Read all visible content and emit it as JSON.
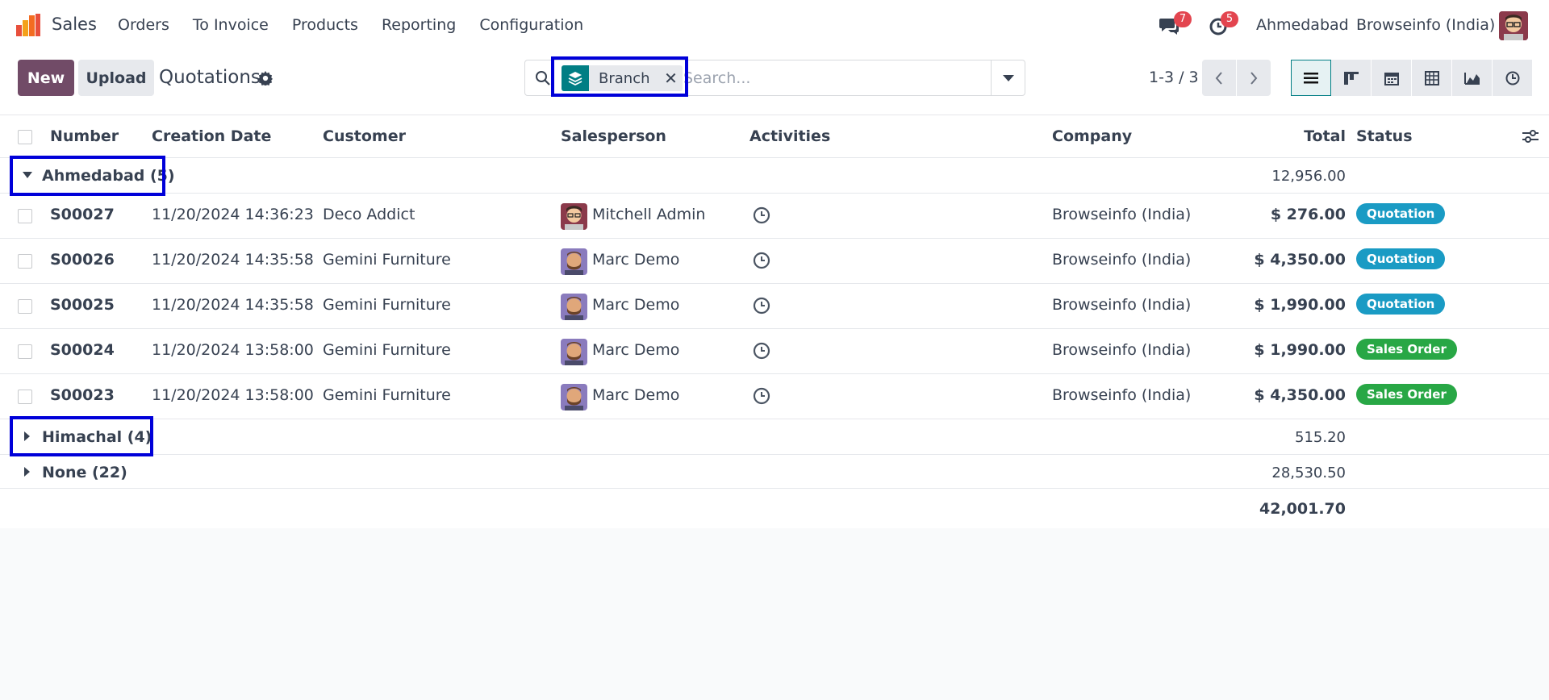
{
  "navbar": {
    "app_name": "Sales",
    "menu": [
      "Orders",
      "To Invoice",
      "Products",
      "Reporting",
      "Configuration"
    ],
    "messages_count": "7",
    "activities_count": "5",
    "branch": "Ahmedabad",
    "company": "Browseinfo (India)"
  },
  "control": {
    "new_label": "New",
    "upload_label": "Upload",
    "title": "Quotations",
    "facet_label": "Branch",
    "search_placeholder": "Search...",
    "pager": "1-3 / 3"
  },
  "table": {
    "headers": {
      "number": "Number",
      "creation_date": "Creation Date",
      "customer": "Customer",
      "salesperson": "Salesperson",
      "activities": "Activities",
      "company": "Company",
      "total": "Total",
      "status": "Status"
    },
    "groups": [
      {
        "label": "Ahmedabad (5)",
        "total": "12,956.00",
        "expanded": true
      },
      {
        "label": "Himachal (4)",
        "total": "515.20",
        "expanded": false
      },
      {
        "label": "None (22)",
        "total": "28,530.50",
        "expanded": false
      }
    ],
    "rows": [
      {
        "number": "S00027",
        "date": "11/20/2024 14:36:23",
        "customer": "Deco Addict",
        "salesperson": "Mitchell Admin",
        "company": "Browseinfo (India)",
        "total": "$ 276.00",
        "status": "Quotation"
      },
      {
        "number": "S00026",
        "date": "11/20/2024 14:35:58",
        "customer": "Gemini Furniture",
        "salesperson": "Marc Demo",
        "company": "Browseinfo (India)",
        "total": "$ 4,350.00",
        "status": "Quotation"
      },
      {
        "number": "S00025",
        "date": "11/20/2024 14:35:58",
        "customer": "Gemini Furniture",
        "salesperson": "Marc Demo",
        "company": "Browseinfo (India)",
        "total": "$ 1,990.00",
        "status": "Quotation"
      },
      {
        "number": "S00024",
        "date": "11/20/2024 13:58:00",
        "customer": "Gemini Furniture",
        "salesperson": "Marc Demo",
        "company": "Browseinfo (India)",
        "total": "$ 1,990.00",
        "status": "Sales Order"
      },
      {
        "number": "S00023",
        "date": "11/20/2024 13:58:00",
        "customer": "Gemini Furniture",
        "salesperson": "Marc Demo",
        "company": "Browseinfo (India)",
        "total": "$ 4,350.00",
        "status": "Sales Order"
      }
    ],
    "grand_total": "42,001.70"
  },
  "colors": {
    "brand": "#714b67",
    "teal": "#017e84",
    "quotation_badge": "#1a9bc4",
    "sales_order_badge": "#28a745",
    "highlight": "#0000d9"
  }
}
